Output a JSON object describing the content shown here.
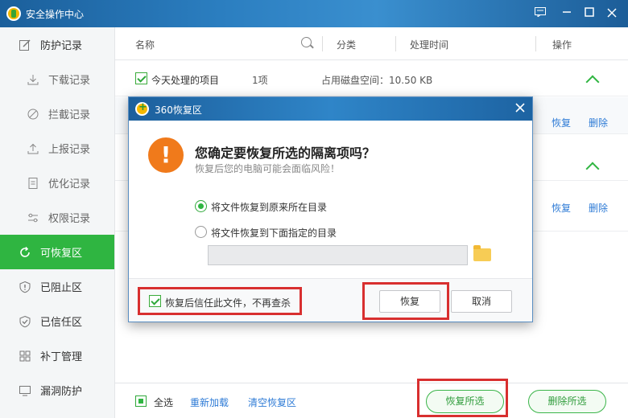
{
  "window": {
    "title": "安全操作中心"
  },
  "sidebar": {
    "items": [
      {
        "label": "防护记录",
        "icon": "edit-icon"
      },
      {
        "label": "下载记录",
        "icon": "download-icon"
      },
      {
        "label": "拦截记录",
        "icon": "block-icon"
      },
      {
        "label": "上报记录",
        "icon": "upload-icon"
      },
      {
        "label": "优化记录",
        "icon": "document-icon"
      },
      {
        "label": "权限记录",
        "icon": "sliders-icon"
      },
      {
        "label": "可恢复区",
        "icon": "refresh-icon"
      },
      {
        "label": "已阻止区",
        "icon": "shield-alert-icon"
      },
      {
        "label": "已信任区",
        "icon": "shield-check-icon"
      },
      {
        "label": "补丁管理",
        "icon": "grid-icon"
      },
      {
        "label": "漏洞防护",
        "icon": "monitor-icon"
      }
    ]
  },
  "table": {
    "headers": {
      "name": "名称",
      "category": "分类",
      "time": "处理时间",
      "action": "操作"
    },
    "group": {
      "label": "今天处理的项目",
      "count": "1项",
      "disk": "占用磁盘空间：10.50 KB"
    },
    "row_actions": {
      "restore": "恢复",
      "delete": "删除"
    }
  },
  "bottom": {
    "select_all": "全选",
    "reload": "重新加载",
    "clear": "清空恢复区",
    "restore_selected": "恢复所选",
    "delete_selected": "删除所选"
  },
  "dialog": {
    "title": "360恢复区",
    "heading": "您确定要恢复所选的隔离项吗？",
    "subtext": "恢复后您的电脑可能会面临风险！",
    "option_original": "将文件恢复到原来所在目录",
    "option_custom": "将文件恢复到下面指定的目录",
    "path_value": "",
    "trust_checkbox": "恢复后信任此文件，不再查杀",
    "restore_button": "恢复",
    "cancel_button": "取消"
  },
  "colors": {
    "accent": "#2fb541",
    "titlebar": "#2b7ec0",
    "highlight": "#d82f2f",
    "warning": "#f07a1b"
  }
}
